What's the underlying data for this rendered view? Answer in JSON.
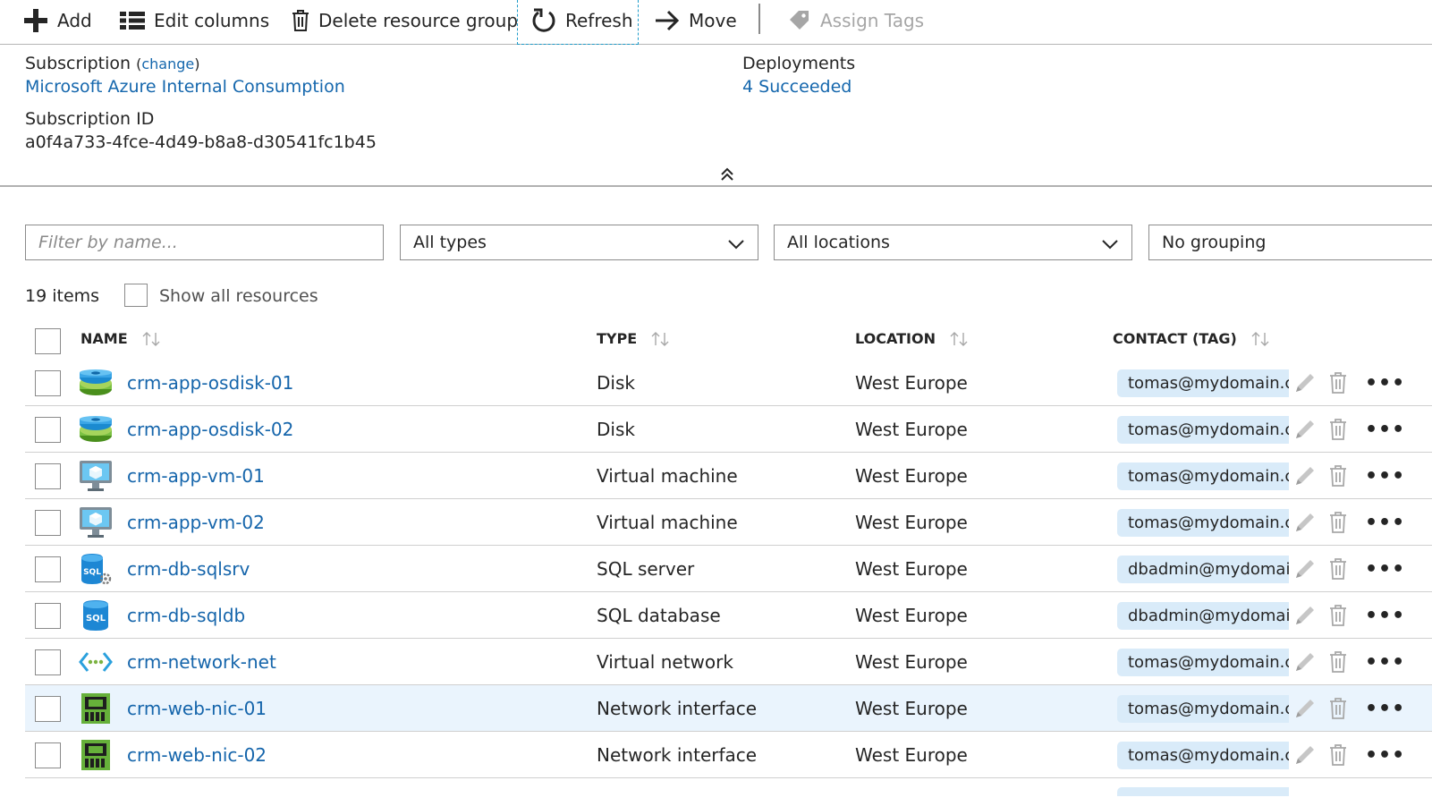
{
  "toolbar": {
    "add": "Add",
    "edit_columns": "Edit columns",
    "delete_group": "Delete resource group",
    "refresh": "Refresh",
    "move": "Move",
    "assign_tags": "Assign Tags"
  },
  "essentials": {
    "subscription_label": "Subscription",
    "change_open": "(",
    "change_link": "change",
    "change_close": ")",
    "subscription_name": "Microsoft Azure Internal Consumption",
    "subscription_id_label": "Subscription ID",
    "subscription_id": "a0f4a733-4fce-4d49-b8a8-d30541fc1b45",
    "deployments_label": "Deployments",
    "deployments_value": "4 Succeeded"
  },
  "filters": {
    "name_placeholder": "Filter by name...",
    "types": "All types",
    "locations": "All locations",
    "grouping": "No grouping"
  },
  "list": {
    "count": "19 items",
    "show_all": "Show all resources",
    "columns": {
      "name": "NAME",
      "type": "TYPE",
      "location": "LOCATION",
      "contact": "CONTACT (TAG)"
    },
    "rows": [
      {
        "name": "crm-app-osdisk-01",
        "type": "Disk",
        "location": "West Europe",
        "contact": "tomas@mydomain.co",
        "icon": "disk-icon"
      },
      {
        "name": "crm-app-osdisk-02",
        "type": "Disk",
        "location": "West Europe",
        "contact": "tomas@mydomain.co",
        "icon": "disk-icon"
      },
      {
        "name": "crm-app-vm-01",
        "type": "Virtual machine",
        "location": "West Europe",
        "contact": "tomas@mydomain.co",
        "icon": "virtual-machine-icon"
      },
      {
        "name": "crm-app-vm-02",
        "type": "Virtual machine",
        "location": "West Europe",
        "contact": "tomas@mydomain.co",
        "icon": "virtual-machine-icon"
      },
      {
        "name": "crm-db-sqlsrv",
        "type": "SQL server",
        "location": "West Europe",
        "contact": "dbadmin@mydomain",
        "icon": "sql-server-icon"
      },
      {
        "name": "crm-db-sqldb",
        "type": "SQL database",
        "location": "West Europe",
        "contact": "dbadmin@mydomain",
        "icon": "sql-database-icon"
      },
      {
        "name": "crm-network-net",
        "type": "Virtual network",
        "location": "West Europe",
        "contact": "tomas@mydomain.co",
        "icon": "virtual-network-icon"
      },
      {
        "name": "crm-web-nic-01",
        "type": "Network interface",
        "location": "West Europe",
        "contact": "tomas@mydomain.co",
        "icon": "network-interface-icon",
        "selected": true
      },
      {
        "name": "crm-web-nic-02",
        "type": "Network interface",
        "location": "West Europe",
        "contact": "tomas@mydomain.co",
        "icon": "network-interface-icon"
      }
    ],
    "row_more": "•••",
    "sql_badge": "SQL"
  },
  "colors": {
    "link": "#1567ad",
    "tag_background": "#d9ebf9",
    "selected_row": "#eaf4fd"
  }
}
